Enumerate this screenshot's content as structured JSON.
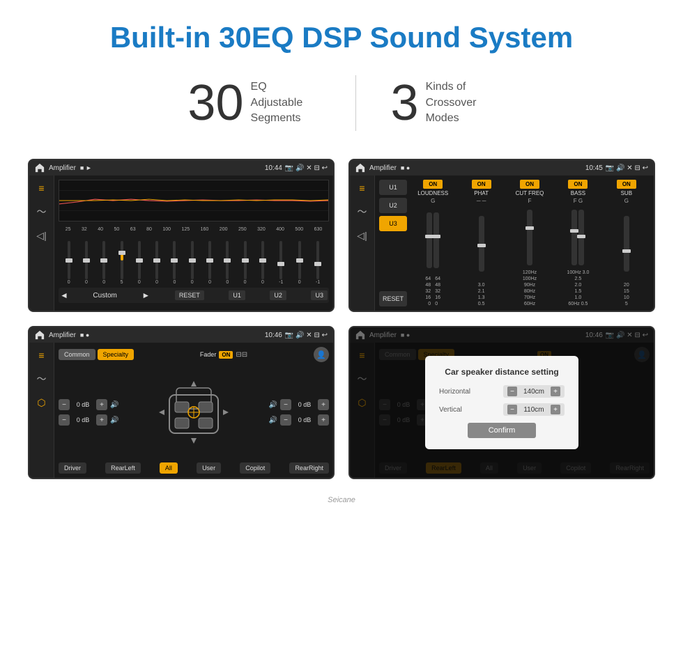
{
  "header": {
    "title": "Built-in 30EQ DSP Sound System"
  },
  "stats": [
    {
      "number": "30",
      "label_line1": "EQ Adjustable",
      "label_line2": "Segments"
    },
    {
      "number": "3",
      "label_line1": "Kinds of",
      "label_line2": "Crossover Modes"
    }
  ],
  "screens": [
    {
      "id": "screen-1",
      "status_bar": {
        "title": "Amplifier",
        "time": "10:44"
      },
      "type": "equalizer",
      "freq_labels": [
        "25",
        "32",
        "40",
        "50",
        "63",
        "80",
        "100",
        "125",
        "160",
        "200",
        "250",
        "320",
        "400",
        "500",
        "630"
      ],
      "eq_values": [
        "0",
        "0",
        "0",
        "5",
        "0",
        "0",
        "0",
        "0",
        "0",
        "0",
        "0",
        "0",
        "-1",
        "0",
        "-1"
      ],
      "bottom_controls": [
        "Custom",
        "RESET",
        "U1",
        "U2",
        "U3"
      ]
    },
    {
      "id": "screen-2",
      "status_bar": {
        "title": "Amplifier",
        "time": "10:45"
      },
      "type": "crossover",
      "presets": [
        "U1",
        "U2",
        "U3"
      ],
      "active_preset": "U3",
      "channels": [
        {
          "label": "LOUDNESS",
          "on": true
        },
        {
          "label": "PHAT",
          "on": true
        },
        {
          "label": "CUT FREQ",
          "on": true
        },
        {
          "label": "BASS",
          "on": true
        },
        {
          "label": "SUB",
          "on": true
        }
      ],
      "reset_label": "RESET"
    },
    {
      "id": "screen-3",
      "status_bar": {
        "title": "Amplifier",
        "time": "10:46"
      },
      "type": "speaker",
      "common_label": "Common",
      "specialty_label": "Specialty",
      "fader_label": "Fader",
      "on_label": "ON",
      "vol_fl": "0 dB",
      "vol_fr": "0 dB",
      "vol_rl": "0 dB",
      "vol_rr": "0 dB",
      "bottom_btns": [
        "Driver",
        "RearLeft",
        "All",
        "User",
        "Copilot",
        "RearRight"
      ],
      "active_btn": "All"
    },
    {
      "id": "screen-4",
      "status_bar": {
        "title": "Amplifier",
        "time": "10:46"
      },
      "type": "speaker-dialog",
      "common_label": "Common",
      "specialty_label": "Specialty",
      "on_label": "ON",
      "vol_fr": "0 dB",
      "vol_rr": "0 dB",
      "bottom_btns": [
        "Driver",
        "RearLeft",
        "All",
        "User",
        "Copilot",
        "RearRight"
      ],
      "dialog": {
        "title": "Car speaker distance setting",
        "horizontal_label": "Horizontal",
        "horizontal_value": "140cm",
        "vertical_label": "Vertical",
        "vertical_value": "110cm",
        "confirm_label": "Confirm"
      }
    }
  ],
  "watermark": "Seicane"
}
